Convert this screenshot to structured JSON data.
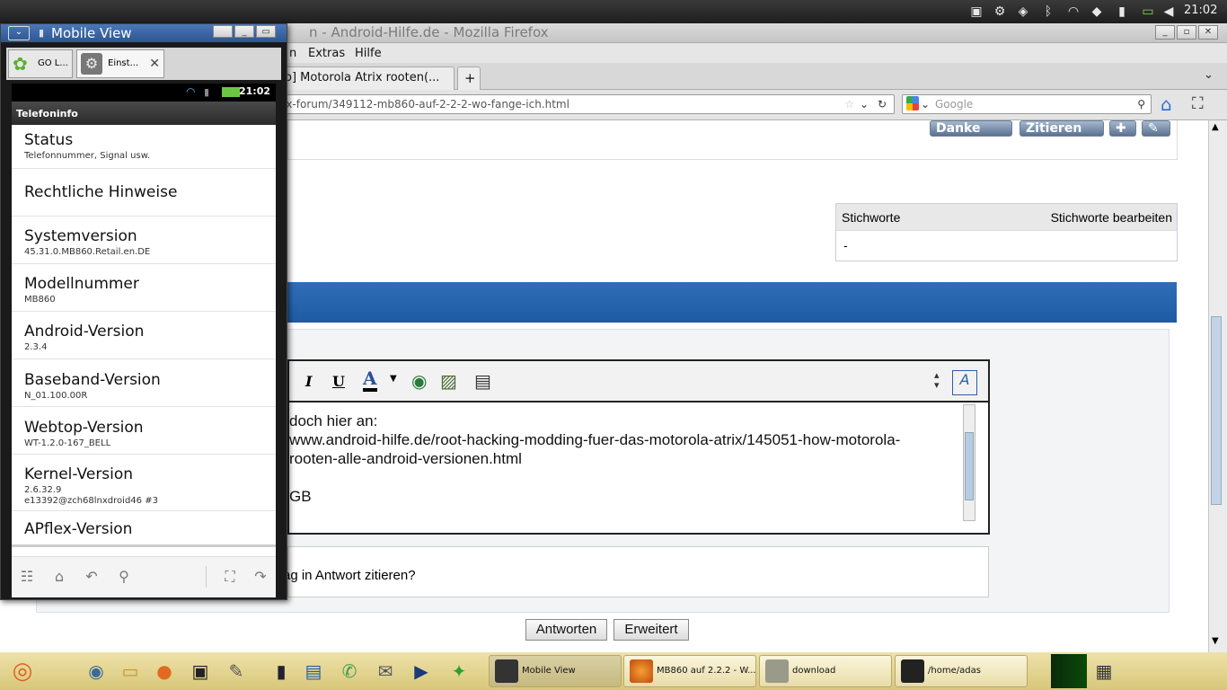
{
  "topbar": {
    "clock": "21:02"
  },
  "firefox": {
    "title": "n - Android-Hilfe.de - Mozilla Firefox",
    "menu": [
      "n",
      "Extras",
      "Hilfe"
    ],
    "tabs": [
      {
        "label": "o] Motorola Atrix rooten(..."
      }
    ],
    "new_tab": "+",
    "url": "ix-forum/349112-mb860-auf-2-2-2-wo-fange-ich.html",
    "search_placeholder": "Google"
  },
  "page": {
    "post_buttons": [
      "Danke",
      "Zitieren"
    ],
    "tags": {
      "header": "Stichworte",
      "edit_link": "Stichworte bearbeiten",
      "value": "-"
    },
    "editor": {
      "lines": [
        "doch hier an:",
        "www.android-hilfe.de/root-hacking-modding-fuer-das-motorola-atrix/145051-how-motorola-",
        "rooten-alle-android-versionen.html",
        "",
        "GB"
      ]
    },
    "quote_option": "ag in Antwort zitieren?",
    "buttons": {
      "reply": "Antworten",
      "advanced": "Erweitert"
    }
  },
  "mobile": {
    "window_title": "Mobile View",
    "tabs": [
      {
        "label": "GO L..."
      },
      {
        "label": "Einst..."
      }
    ],
    "status_clock": "21:02",
    "header": "Telefoninfo",
    "items": [
      {
        "title": "Status",
        "subtitle": "Telefonnummer, Signal usw."
      },
      {
        "title": "Rechtliche Hinweise",
        "subtitle": ""
      },
      {
        "title": "Systemversion",
        "subtitle": "45.31.0.MB860.Retail.en.DE"
      },
      {
        "title": "Modellnummer",
        "subtitle": "MB860"
      },
      {
        "title": "Android-Version",
        "subtitle": "2.3.4"
      },
      {
        "title": "Baseband-Version",
        "subtitle": "N_01.100.00R"
      },
      {
        "title": "Webtop-Version",
        "subtitle": "WT-1.2.0-167_BELL"
      },
      {
        "title": "Kernel-Version",
        "subtitle": "2.6.32.9",
        "subtitle2": "e13392@zch68lnxdroid46 #3"
      },
      {
        "title": "APflex-Version",
        "subtitle": ""
      }
    ]
  },
  "taskbar": {
    "tasks": [
      "Mobile View",
      "MB860 auf 2.2.2 - W...",
      "download",
      "/home/adas"
    ]
  },
  "colors": {
    "accent_blue": "#1e5aa3",
    "taskbar": "#e2d390",
    "title_blue": "#3b69a8"
  }
}
